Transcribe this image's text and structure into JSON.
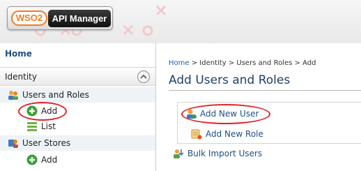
{
  "header": {
    "logo_brand": "WSO2",
    "logo_product": "API Manager"
  },
  "sidebar": {
    "home_label": "Home",
    "identity_label": "Identity",
    "items": [
      {
        "label": "Users and Roles",
        "icon": "users-roles-icon"
      },
      {
        "label": "Add",
        "icon": "add-icon"
      },
      {
        "label": "List",
        "icon": "list-icon"
      },
      {
        "label": "User Stores",
        "icon": "user-stores-icon"
      },
      {
        "label": "Add",
        "icon": "add-icon"
      }
    ]
  },
  "main": {
    "breadcrumb": {
      "home": "Home",
      "sep": ">",
      "identity": "Identity",
      "users_roles": "Users and Roles",
      "current": "Add"
    },
    "title": "Add Users and Roles",
    "actions": [
      {
        "label": "Add New User",
        "icon": "add-user-icon"
      },
      {
        "label": "Add New Role",
        "icon": "add-role-icon"
      },
      {
        "label": "Bulk Import Users",
        "icon": "bulk-import-icon"
      }
    ]
  },
  "colors": {
    "link": "#1f4f82",
    "highlight": "#e0242c",
    "brand_orange": "#f47b20"
  }
}
